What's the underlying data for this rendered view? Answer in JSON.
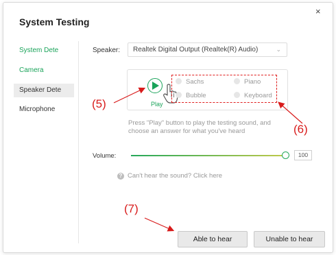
{
  "dialog": {
    "title": "System Testing",
    "close_icon": "×"
  },
  "sidebar": {
    "items": [
      {
        "label": "System Dete",
        "state": "green"
      },
      {
        "label": "Camera",
        "state": "green"
      },
      {
        "label": "Speaker Dete",
        "state": "active"
      },
      {
        "label": "Microphone",
        "state": "plain"
      }
    ]
  },
  "speaker": {
    "label": "Speaker:",
    "selected": "Realtek Digital Output (Realtek(R) Audio)"
  },
  "test": {
    "play_label": "Play",
    "options": [
      "Sachs",
      "Piano",
      "Bubble",
      "Keyboard"
    ],
    "hint": "Press \"Play\" button to play the testing sound, and choose an answer for what you've heard"
  },
  "volume": {
    "label": "Volume:",
    "value": "100"
  },
  "help": {
    "icon": "?",
    "text": "Can't hear the sound? Click here"
  },
  "buttons": {
    "able": "Able to hear",
    "unable": "Unable to hear"
  },
  "annotations": {
    "a5": "(5)",
    "a6": "(6)",
    "a7": "(7)"
  },
  "colors": {
    "accent": "#1aa35a",
    "annotation": "#d81b1b"
  }
}
